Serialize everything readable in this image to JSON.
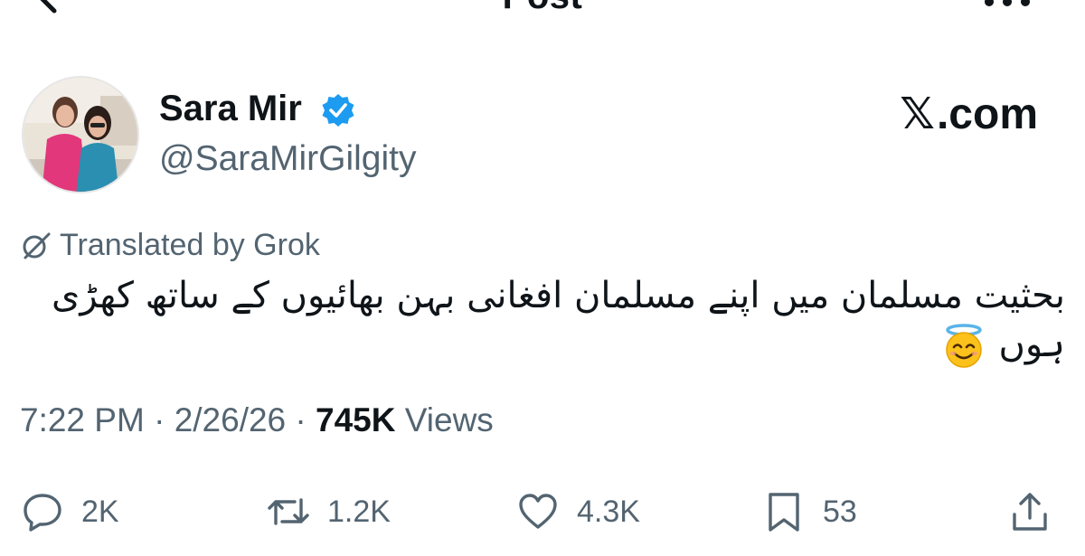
{
  "header": {
    "title": "Post"
  },
  "author": {
    "display_name": "Sara Mir",
    "handle": "@SaraMirGilgity",
    "verified": true
  },
  "brand": {
    "x_glyph": "𝕏",
    "domain": ".com"
  },
  "translation": {
    "label": "Translated by Grok"
  },
  "tweet": {
    "text": "بحثیت مسلمان میں اپنے مسلمان افغانی بہن بھائیوں کے ساتھ کھڑی ہوں",
    "emoji": "smiling-face-with-halo"
  },
  "meta": {
    "time": "7:22 PM",
    "date": "2/26/26",
    "separator": "·",
    "views_count": "745K",
    "views_label": "Views"
  },
  "actions": {
    "reply_count": "2K",
    "repost_count": "1.2K",
    "like_count": "4.3K",
    "bookmark_count": "53"
  },
  "colors": {
    "text_primary": "#0f1419",
    "text_secondary": "#536471",
    "verified_blue": "#1d9bf0"
  }
}
